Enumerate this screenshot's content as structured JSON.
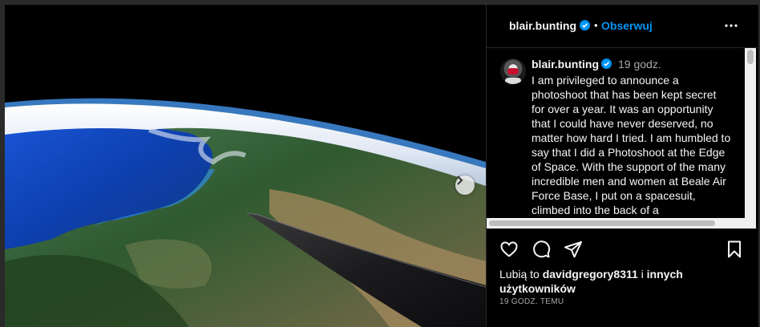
{
  "post": {
    "username": "blair.bunting",
    "follow_label": "Obserwuj",
    "separator": "•",
    "more_icon": "more-horizontal-icon"
  },
  "caption": {
    "username": "blair.bunting",
    "time": "19 godz.",
    "text": "I am privileged to announce a photoshoot that has been kept secret for over a year. It was an opportunity that I could have never deserved, no matter how hard I tried. I am humbled to say that I did a Photoshoot at the Edge of Space. With the support of the many incredible men and women at Beale Air Force Base, I put on a spacesuit, climbed into the back of a"
  },
  "likes": {
    "prefix": "Lubią to ",
    "user": "davidgregory8311",
    "middle": " i ",
    "others": "innych użytkowników"
  },
  "timestamp": "19 GODZ. TEMU",
  "colors": {
    "background": "#000000",
    "accent": "#0095f6",
    "verified": "#0095f6",
    "muted": "#a8a8a8"
  }
}
